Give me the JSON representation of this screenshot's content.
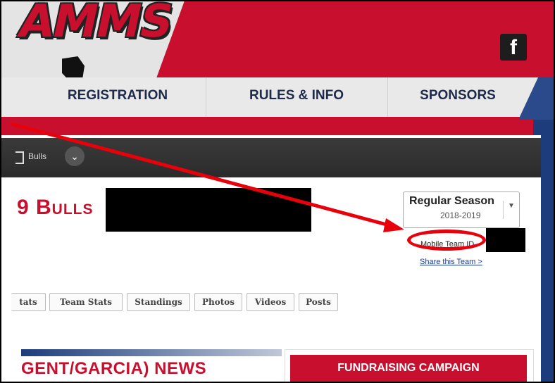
{
  "header": {
    "logo_text": "AMMS",
    "facebook": "f"
  },
  "nav": [
    {
      "label": "REGISTRATION"
    },
    {
      "label": "RULES & INFO"
    },
    {
      "label": "SPONSORS"
    }
  ],
  "team_bar": {
    "crumb": "Bulls"
  },
  "team": {
    "title": "9 Bulls"
  },
  "season": {
    "label": "Regular Season",
    "year": "2018-2019"
  },
  "mobile_team_id_label": "Mobile Team ID",
  "share_link": "Share this Team >",
  "tabs": [
    {
      "label": "tats"
    },
    {
      "label": "Team Stats"
    },
    {
      "label": "Standings"
    },
    {
      "label": "Photos"
    },
    {
      "label": "Videos"
    },
    {
      "label": "Posts"
    }
  ],
  "news": {
    "title": "GENT/GARCIA) NEWS"
  },
  "fundraising": {
    "label": "FUNDRAISING CAMPAIGN"
  },
  "colors": {
    "brand_red": "#c8102e",
    "navy": "#1c3c7c",
    "annotation_red": "#e8000b"
  }
}
